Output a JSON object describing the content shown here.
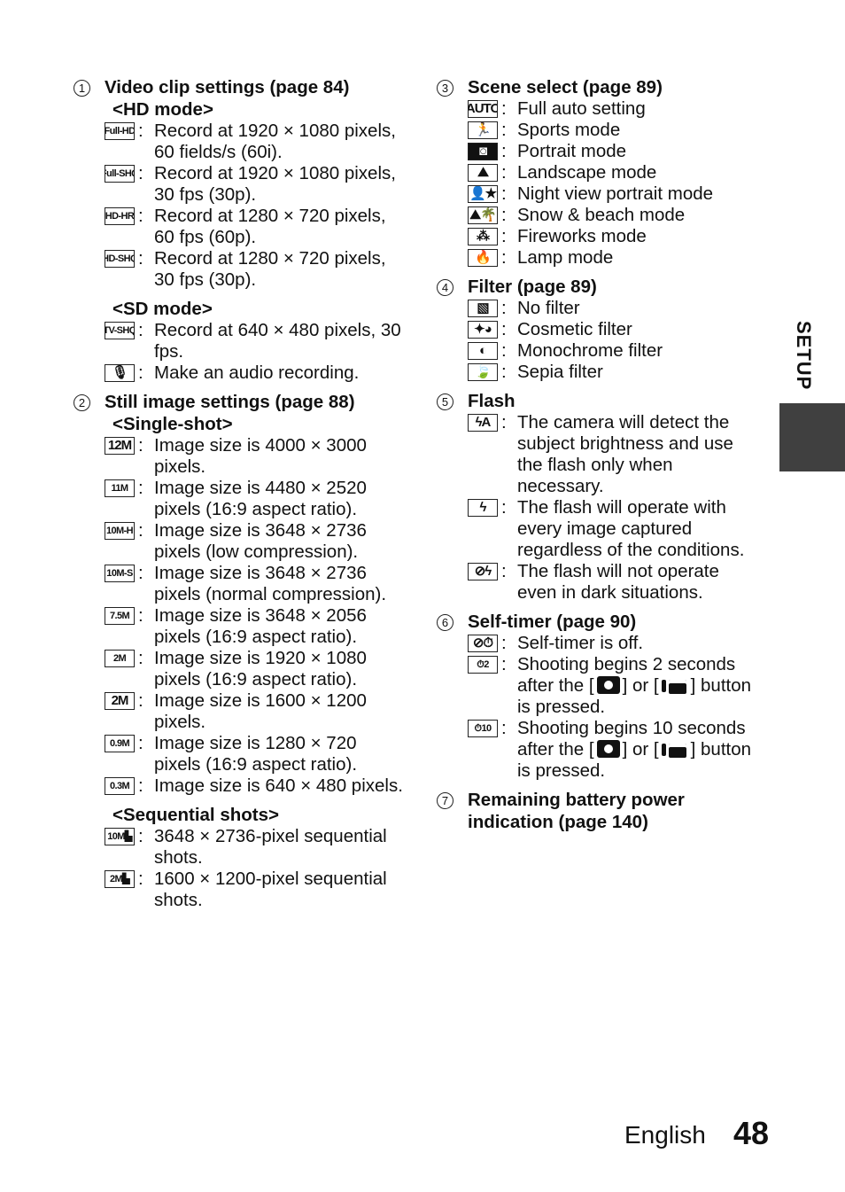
{
  "sections": {
    "s1": {
      "number": "1",
      "title": "Video clip settings (page 84)",
      "hd_mode": "<HD mode>",
      "hd_items": [
        {
          "icon": "Full-HD",
          "text": "Record at 1920 × 1080 pixels, 60 fields/s (60i)."
        },
        {
          "icon": "Full-SHQ",
          "text": "Record at 1920 × 1080 pixels, 30 fps (30p)."
        },
        {
          "icon": "HD-HR",
          "text": "Record at 1280 × 720 pixels, 60 fps (60p)."
        },
        {
          "icon": "HD-SHQ",
          "text": "Record at 1280 × 720 pixels, 30 fps (30p)."
        }
      ],
      "sd_mode": "<SD mode>",
      "sd_items": [
        {
          "icon": "TV-SHQ",
          "text": "Record at 640 × 480 pixels, 30 fps."
        },
        {
          "icon": "🎙",
          "text": "Make an audio recording."
        }
      ]
    },
    "s2": {
      "number": "2",
      "title": "Still image settings (page 88)",
      "single_shot": "<Single-shot>",
      "single_items": [
        {
          "icon": "12M",
          "text": "Image size is 4000 × 3000 pixels."
        },
        {
          "icon": "11M",
          "text": "Image size is 4480 × 2520 pixels (16:9 aspect ratio)."
        },
        {
          "icon": "10M-H",
          "text": "Image size is 3648 × 2736 pixels (low compression)."
        },
        {
          "icon": "10M-S",
          "text": "Image size is 3648 × 2736 pixels (normal compression)."
        },
        {
          "icon": "7.5M",
          "text": "Image size is 3648 × 2056 pixels (16:9 aspect ratio)."
        },
        {
          "icon": "2M",
          "text": "Image size is 1920 × 1080 pixels (16:9 aspect ratio)."
        },
        {
          "icon": "2M",
          "text": "Image size is 1600 × 1200 pixels."
        },
        {
          "icon": "0.9M",
          "text": "Image size is 1280 × 720 pixels (16:9 aspect ratio)."
        },
        {
          "icon": "0.3M",
          "text": "Image size is 640 × 480 pixels."
        }
      ],
      "sequential": "<Sequential shots>",
      "sequential_items": [
        {
          "icon": "10M▙",
          "text": "3648 × 2736-pixel sequential shots."
        },
        {
          "icon": "2M▙",
          "text": "1600 × 1200-pixel sequential shots."
        }
      ]
    },
    "s3": {
      "number": "3",
      "title": "Scene select (page 89)",
      "items": [
        {
          "icon": "AUTO",
          "text": "Full auto setting"
        },
        {
          "icon": "🏃",
          "text": "Sports mode"
        },
        {
          "icon": "◙",
          "text": "Portrait mode"
        },
        {
          "icon": "⛰",
          "text": "Landscape mode"
        },
        {
          "icon": "👤★",
          "text": "Night view portrait mode"
        },
        {
          "icon": "⛰🌴",
          "text": "Snow & beach mode"
        },
        {
          "icon": "⁂",
          "text": "Fireworks mode"
        },
        {
          "icon": "🔥",
          "text": "Lamp mode"
        }
      ]
    },
    "s4": {
      "number": "4",
      "title": "Filter (page 89)",
      "items": [
        {
          "icon": "▧",
          "text": "No filter"
        },
        {
          "icon": "✦◕",
          "text": "Cosmetic filter"
        },
        {
          "icon": "◐",
          "text": "Monochrome filter"
        },
        {
          "icon": "🍃",
          "text": "Sepia filter"
        }
      ]
    },
    "s5": {
      "number": "5",
      "title": "Flash",
      "items": [
        {
          "icon": "ϟA",
          "text": "The camera will detect the subject brightness and use the flash only when necessary."
        },
        {
          "icon": "ϟ",
          "text": "The flash will operate with every image captured regardless of the conditions."
        },
        {
          "icon": "⊘ϟ",
          "text": "The flash will not operate even in dark situations."
        }
      ]
    },
    "s6": {
      "number": "6",
      "title": "Self-timer (page 90)",
      "items": [
        {
          "icon": "⊘⏱",
          "text": "Self-timer is off."
        },
        {
          "icon": "⏱2",
          "text_a": "Shooting begins 2 seconds after the [",
          "text_b": "] or [",
          "text_c": "] button is pressed."
        },
        {
          "icon": "⏱10",
          "text_a": "Shooting begins 10 seconds after the [",
          "text_b": "] or [",
          "text_c": "] button is pressed."
        }
      ]
    },
    "s7": {
      "number": "7",
      "title": "Remaining battery power indication (page 140)"
    }
  },
  "side_tab": {
    "label": "SETUP",
    "color": "#404040"
  },
  "footer": {
    "language": "English",
    "page_number": "48"
  },
  "colon": ":"
}
